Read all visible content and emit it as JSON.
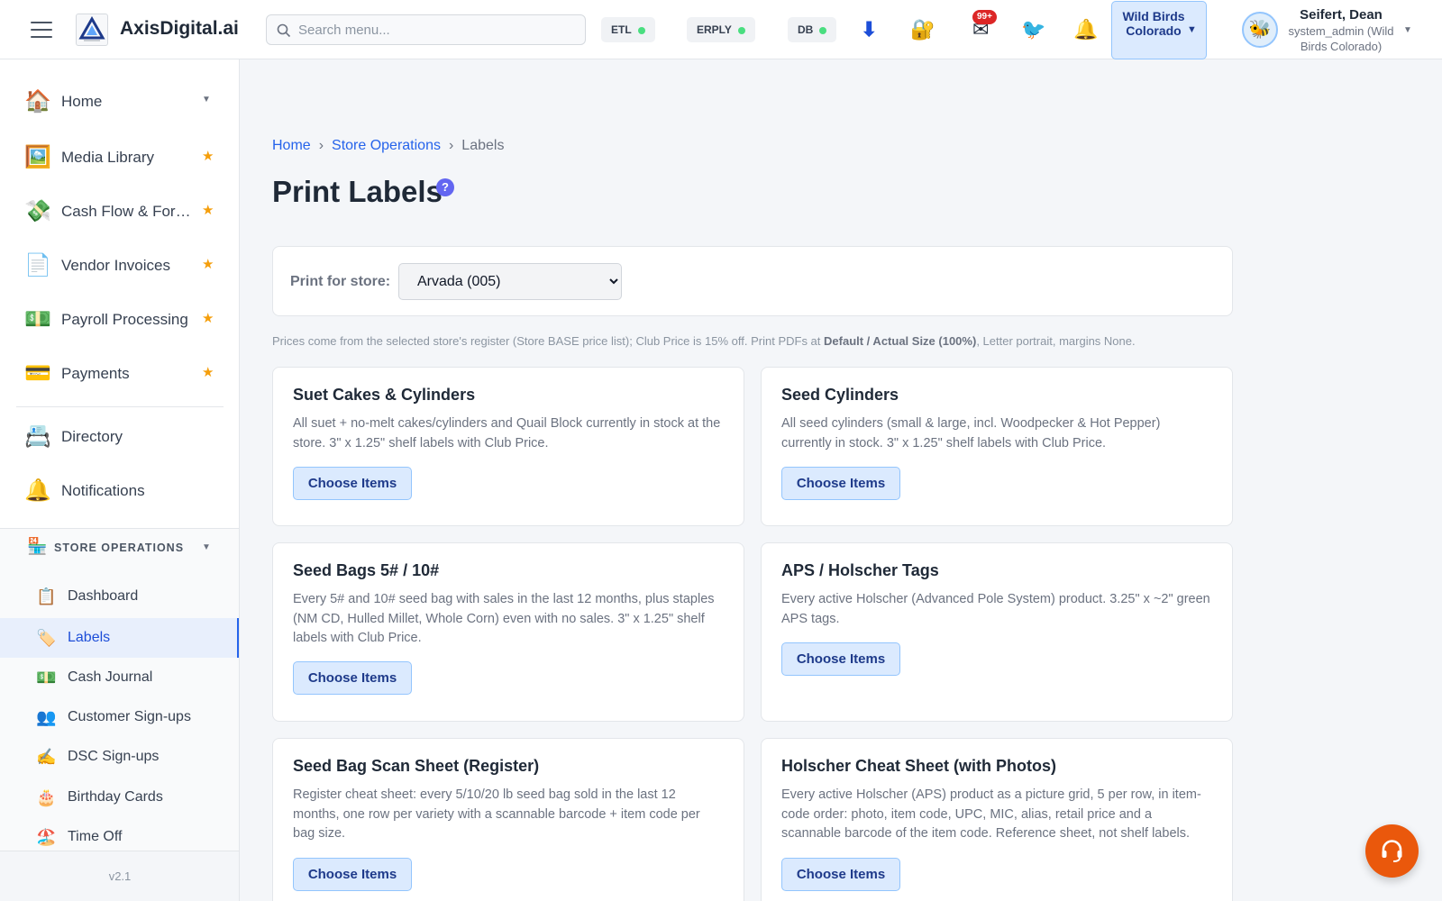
{
  "header": {
    "brand": "AxisDigital.ai",
    "search_placeholder": "Search menu...",
    "status": [
      {
        "label": "ETL",
        "state": "ok"
      },
      {
        "label": "ERPLY",
        "state": "ok"
      },
      {
        "label": "DB",
        "state": "ok"
      }
    ],
    "icons": [
      "download-icon",
      "lock-icon",
      "mail-icon",
      "bird-icon",
      "bell-icon"
    ],
    "mail_badge": "99+",
    "org_name": "Wild Birds Colorado",
    "user_name": "Seifert, Dean",
    "user_role": "system_admin (Wild Birds Colorado)"
  },
  "sidebar": {
    "items": [
      {
        "label": "Home",
        "icon": "house-icon",
        "marker": "caret"
      },
      {
        "label": "Media Library",
        "icon": "picture-icon",
        "marker": "star"
      },
      {
        "label": "Cash Flow & Forecasting",
        "icon": "money-wings-icon",
        "marker": "star"
      },
      {
        "label": "Vendor Invoices",
        "icon": "document-icon",
        "marker": "star"
      },
      {
        "label": "Payroll Processing",
        "icon": "cash-icon",
        "marker": "star"
      },
      {
        "label": "Payments",
        "icon": "credit-card-icon",
        "marker": "star"
      },
      {
        "label": "Directory",
        "icon": "card-index-icon",
        "marker": ""
      },
      {
        "label": "Notifications",
        "icon": "bell-icon",
        "marker": ""
      }
    ],
    "section": {
      "label": "STORE OPERATIONS",
      "icon": "store-icon"
    },
    "sub_items": [
      {
        "label": "Dashboard",
        "icon": "clipboard-icon",
        "active": false
      },
      {
        "label": "Labels",
        "icon": "tag-icon",
        "active": true
      },
      {
        "label": "Cash Journal",
        "icon": "cash-icon",
        "active": false
      },
      {
        "label": "Customer Sign-ups",
        "icon": "people-icon",
        "active": false
      },
      {
        "label": "DSC Sign-ups",
        "icon": "writing-hand-icon",
        "active": false
      },
      {
        "label": "Birthday Cards",
        "icon": "cake-icon",
        "active": false
      },
      {
        "label": "Time Off",
        "icon": "umbrella-icon",
        "active": false
      }
    ],
    "version": "v2.1"
  },
  "breadcrumb": {
    "home": "Home",
    "section": "Store Operations",
    "current": "Labels"
  },
  "page": {
    "title": "Print Labels",
    "help": "?",
    "store_label": "Print for store:",
    "store_selected": "Arvada (005)",
    "info_prefix": "Prices come from the selected store's register (Store BASE price list); Club Price is 15% off. Print PDFs at ",
    "info_bold": "Default / Actual Size (100%)",
    "info_suffix": ", Letter portrait, margins None."
  },
  "cards": [
    {
      "title": "Suet Cakes & Cylinders",
      "desc": "All suet + no-melt cakes/cylinders and Quail Block currently in stock at the store. 3\" x 1.25\" shelf labels with Club Price.",
      "button": "Choose Items"
    },
    {
      "title": "Seed Cylinders",
      "desc": "All seed cylinders (small & large, incl. Woodpecker & Hot Pepper) currently in stock. 3\" x 1.25\" shelf labels with Club Price.",
      "button": "Choose Items"
    },
    {
      "title": "Seed Bags 5# / 10#",
      "desc": "Every 5# and 10# seed bag with sales in the last 12 months, plus staples (NM CD, Hulled Millet, Whole Corn) even with no sales. 3\" x 1.25\" shelf labels with Club Price.",
      "button": "Choose Items"
    },
    {
      "title": "APS / Holscher Tags",
      "desc": "Every active Holscher (Advanced Pole System) product. 3.25\" x ~2\" green APS tags.",
      "button": "Choose Items"
    },
    {
      "title": "Seed Bag Scan Sheet (Register)",
      "desc": "Register cheat sheet: every 5/10/20 lb seed bag sold in the last 12 months, one row per variety with a scannable barcode + item code per bag size.",
      "button": "Choose Items"
    },
    {
      "title": "Holscher Cheat Sheet (with Photos)",
      "desc": "Every active Holscher (APS) product as a picture grid, 5 per row, in item-code order: photo, item code, UPC, MIC, alias, retail price and a scannable barcode of the item code. Reference sheet, not shelf labels.",
      "button": "Choose Items"
    }
  ],
  "colors": {
    "accent": "#2563eb",
    "button_bg": "#dbeafe",
    "status_ok": "#4ade80",
    "badge": "#dc2626",
    "fab": "#ea580c",
    "help": "#6366f1"
  }
}
